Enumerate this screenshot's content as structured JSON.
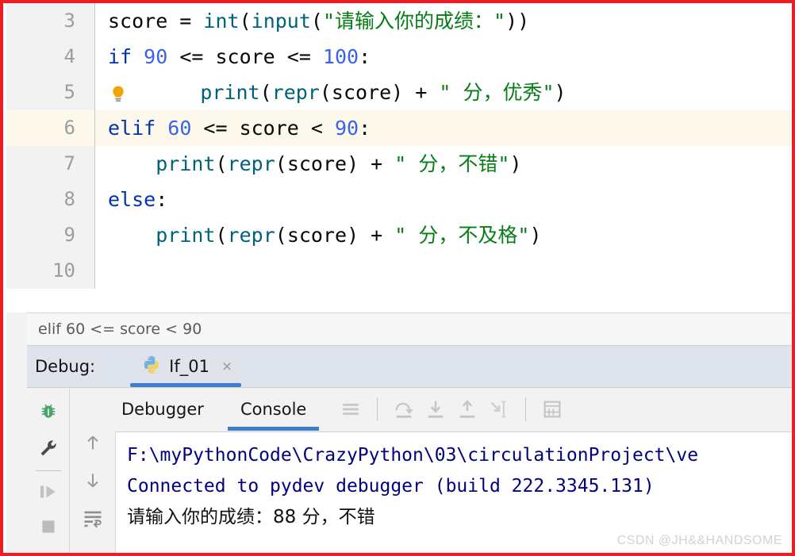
{
  "editor": {
    "lines": [
      {
        "number": "3",
        "highlight": false,
        "bulb": false,
        "indent": 0,
        "tokens": [
          {
            "t": "plain",
            "v": "score = "
          },
          {
            "t": "fn",
            "v": "int"
          },
          {
            "t": "plain",
            "v": "("
          },
          {
            "t": "fn",
            "v": "input"
          },
          {
            "t": "plain",
            "v": "("
          },
          {
            "t": "str",
            "v": "\"请输入你的成绩："
          },
          {
            "t": "str",
            "v": "\""
          },
          {
            "t": "plain",
            "v": "))"
          }
        ]
      },
      {
        "number": "4",
        "highlight": false,
        "bulb": false,
        "indent": 0,
        "tokens": [
          {
            "t": "kw",
            "v": "if "
          },
          {
            "t": "num",
            "v": "90"
          },
          {
            "t": "plain",
            "v": " <= score <= "
          },
          {
            "t": "num",
            "v": "100"
          },
          {
            "t": "plain",
            "v": ":"
          }
        ]
      },
      {
        "number": "5",
        "highlight": false,
        "bulb": true,
        "indent": 1,
        "tokens": [
          {
            "t": "fn",
            "v": "print"
          },
          {
            "t": "plain",
            "v": "("
          },
          {
            "t": "fn",
            "v": "repr"
          },
          {
            "t": "plain",
            "v": "(score) + "
          },
          {
            "t": "str",
            "v": "\" 分，优秀\""
          },
          {
            "t": "plain",
            "v": ")"
          }
        ]
      },
      {
        "number": "6",
        "highlight": true,
        "bulb": false,
        "indent": 0,
        "tokens": [
          {
            "t": "kw",
            "v": "elif "
          },
          {
            "t": "num",
            "v": "60"
          },
          {
            "t": "plain",
            "v": " <= score < "
          },
          {
            "t": "num",
            "v": "90"
          },
          {
            "t": "plain",
            "v": ":"
          }
        ]
      },
      {
        "number": "7",
        "highlight": false,
        "bulb": false,
        "indent": 1,
        "tokens": [
          {
            "t": "fn",
            "v": "print"
          },
          {
            "t": "plain",
            "v": "("
          },
          {
            "t": "fn",
            "v": "repr"
          },
          {
            "t": "plain",
            "v": "(score) + "
          },
          {
            "t": "str",
            "v": "\" 分，不错\""
          },
          {
            "t": "plain",
            "v": ")"
          }
        ]
      },
      {
        "number": "8",
        "highlight": false,
        "bulb": false,
        "indent": 0,
        "tokens": [
          {
            "t": "kw",
            "v": "else"
          },
          {
            "t": "plain",
            "v": ":"
          }
        ]
      },
      {
        "number": "9",
        "highlight": false,
        "bulb": false,
        "indent": 1,
        "tokens": [
          {
            "t": "fn",
            "v": "print"
          },
          {
            "t": "plain",
            "v": "("
          },
          {
            "t": "fn",
            "v": "repr"
          },
          {
            "t": "plain",
            "v": "(score) + "
          },
          {
            "t": "str",
            "v": "\" 分，不及格\""
          },
          {
            "t": "plain",
            "v": ")"
          }
        ]
      },
      {
        "number": "10",
        "highlight": false,
        "bulb": false,
        "indent": 0,
        "tokens": []
      }
    ]
  },
  "breadcrumb": {
    "text": "elif 60 <= score < 90"
  },
  "debug_header": {
    "label": "Debug:",
    "tab_name": "If_01",
    "tab_icon": "python-file-icon",
    "close_label": "×"
  },
  "tool_pane": {
    "tabs": [
      {
        "label": "Debugger",
        "active": false
      },
      {
        "label": "Console",
        "active": true
      }
    ],
    "toolbar_icons": [
      "hamburger-menu-icon",
      "step-over-icon",
      "step-into-icon",
      "step-out-icon",
      "run-to-cursor-icon",
      "evaluate-expression-icon"
    ],
    "rail_icons": [
      "debug-bug-icon",
      "settings-wrench-icon",
      "resume-program-icon",
      "stop-program-icon"
    ],
    "rail2_icons": [
      "scroll-up-icon",
      "scroll-down-icon",
      "soft-wrap-icon"
    ]
  },
  "console": {
    "lines": [
      {
        "text": "F:\\myPythonCode\\CrazyPython\\03\\circulationProject\\ve",
        "kind": "path"
      },
      {
        "text": "Connected to pydev debugger (build 222.3345.131)",
        "kind": "info"
      },
      {
        "text": "请输入你的成绩：88 分，不错",
        "kind": "output"
      }
    ]
  },
  "watermark": {
    "text": "CSDN @JH&&HANDSOME"
  },
  "colors": {
    "border": "#ee1c25",
    "keyword": "#0033b3",
    "number": "#3b63e8",
    "string": "#067d17",
    "function": "#00627a",
    "console_text": "#000080",
    "accent": "#3e7ed0",
    "line_highlight": "#fcf9ec"
  }
}
